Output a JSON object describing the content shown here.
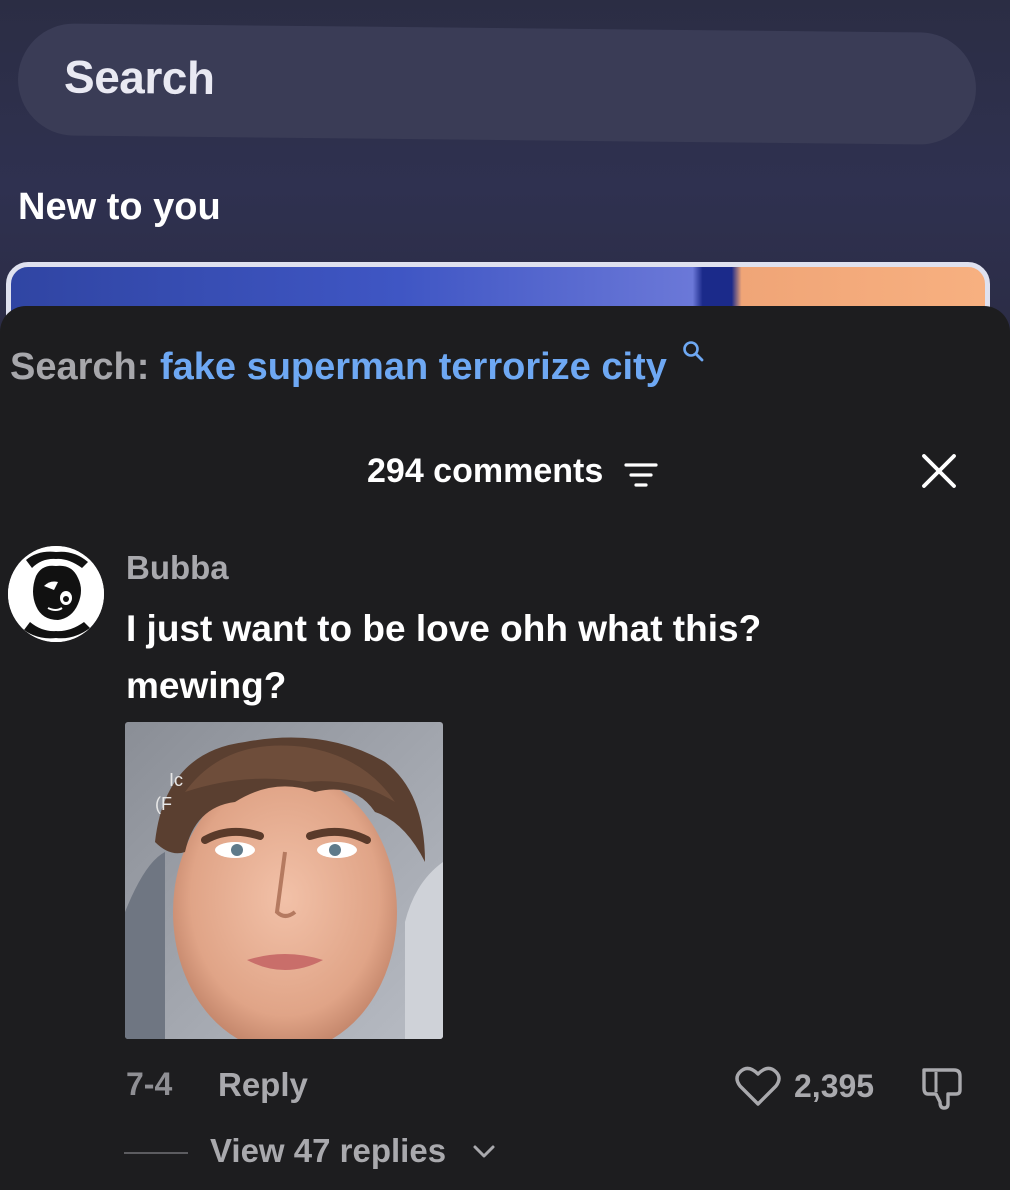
{
  "background": {
    "search_label": "Search",
    "section_title": "New to you"
  },
  "search_bar": {
    "prefix": "Search:",
    "query": "fake superman terrorize city",
    "icon": "search-icon"
  },
  "comments_header": {
    "count_label": "294 comments",
    "sort_icon": "sort-icon",
    "close_icon": "close-icon"
  },
  "comment": {
    "username": "Bubba",
    "text": "I just want to be love ohh what this? mewing?",
    "date": "7-4",
    "reply_label": "Reply",
    "like_count": "2,395",
    "view_replies_label": "View 47 replies"
  },
  "colors": {
    "sheet_background": "#1d1d1f",
    "query_blue": "#6ea8f3",
    "muted_text": "#a9a9ad"
  }
}
